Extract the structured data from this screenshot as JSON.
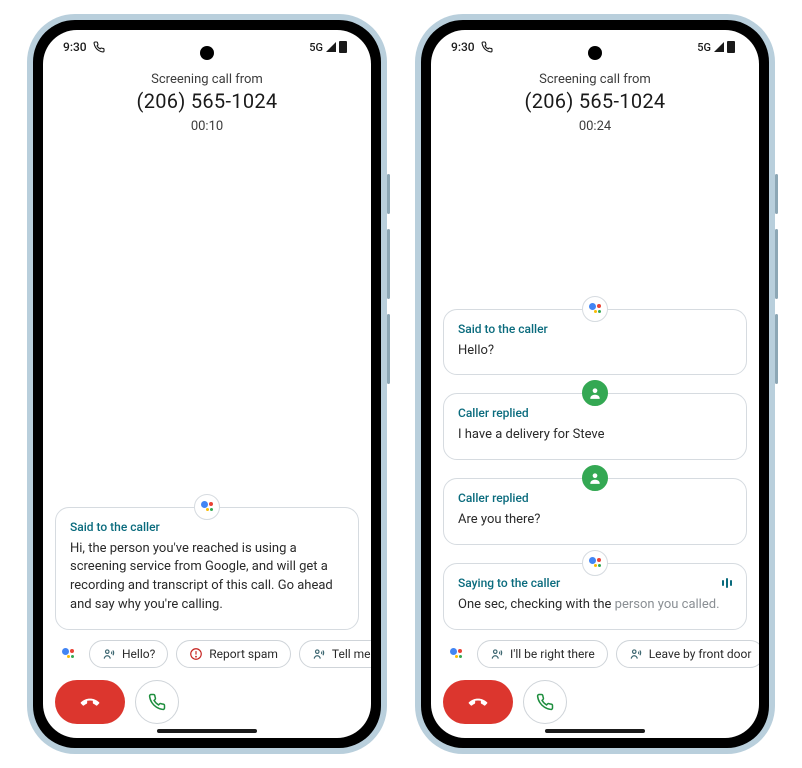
{
  "status": {
    "time": "9:30",
    "net": "5G"
  },
  "left": {
    "header": {
      "sub": "Screening call from",
      "num": "(206) 565-1024",
      "dur": "00:10"
    },
    "msg1": {
      "label": "Said to the caller",
      "text": "Hi, the person you've reached is using a screening service from Google, and will get a recording and transcript of this call. Go ahead and say why you're calling."
    },
    "chips": {
      "c1": "Hello?",
      "c2": "Report spam",
      "c3": "Tell me mo"
    }
  },
  "right": {
    "header": {
      "sub": "Screening call from",
      "num": "(206) 565-1024",
      "dur": "00:24"
    },
    "m1": {
      "label": "Said to the caller",
      "text": "Hello?"
    },
    "m2": {
      "label": "Caller replied",
      "text": "I have a delivery for Steve"
    },
    "m3": {
      "label": "Caller replied",
      "text": "Are you there?"
    },
    "m4": {
      "label": "Saying to the caller",
      "text": "One sec, checking with the ",
      "text_muted": "person you called."
    },
    "chips": {
      "c1": "I'll be right there",
      "c2": "Leave by front door"
    }
  }
}
